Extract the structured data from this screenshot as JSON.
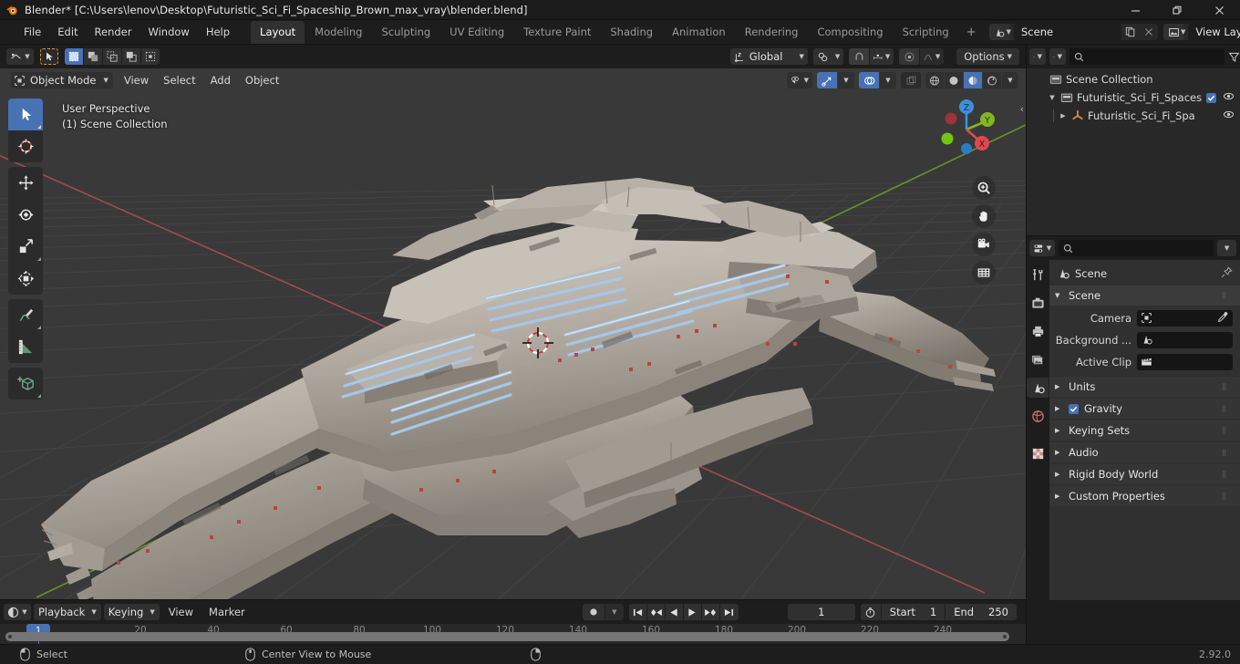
{
  "window": {
    "title": "Blender* [C:\\Users\\lenov\\Desktop\\Futuristic_Sci_Fi_Spaceship_Brown_max_vray\\blender.blend]",
    "minimize": "–",
    "maximize": "❐",
    "close": "✕"
  },
  "topbar": {
    "menus": [
      "File",
      "Edit",
      "Render",
      "Window",
      "Help"
    ],
    "workspaces": [
      {
        "label": "Layout",
        "active": true
      },
      {
        "label": "Modeling",
        "active": false
      },
      {
        "label": "Sculpting",
        "active": false
      },
      {
        "label": "UV Editing",
        "active": false
      },
      {
        "label": "Texture Paint",
        "active": false
      },
      {
        "label": "Shading",
        "active": false
      },
      {
        "label": "Animation",
        "active": false
      },
      {
        "label": "Rendering",
        "active": false
      },
      {
        "label": "Compositing",
        "active": false
      },
      {
        "label": "Scripting",
        "active": false
      }
    ],
    "add_workspace": "+",
    "scene_name": "Scene",
    "view_layer_name": "View Layer"
  },
  "viewport_header": {
    "editor_type_icon": "editor-type-icon",
    "cursor_tool_icon": "cursor-tool-icon",
    "select_modes": [
      "select-set",
      "select-extend",
      "select-subtract",
      "select-invert",
      "select-intersect"
    ],
    "mode": "Object Mode",
    "menus": [
      "View",
      "Select",
      "Add",
      "Object"
    ],
    "transform_orientation": "Global",
    "snap_icon": "magnet-icon",
    "proportional_icon": "proportional-edit-icon",
    "options": "Options",
    "shading_modes": [
      "wireframe",
      "solid",
      "material-preview",
      "rendered"
    ],
    "active_shading": "material-preview"
  },
  "viewport": {
    "perspective_label": "User Perspective",
    "collection_label": "(1) Scene Collection",
    "gizmo_axes": [
      {
        "label": "Z",
        "color": "#3e8fd8"
      },
      {
        "label": "Y",
        "color": "#83b524"
      },
      {
        "label": "X",
        "color": "#e0484f"
      }
    ],
    "nav_buttons": [
      "zoom-icon",
      "pan-hand-icon",
      "camera-view-icon",
      "toggle-ortho-icon"
    ],
    "tools": [
      {
        "name": "tweak-select-tool",
        "selected": true
      },
      {
        "name": "cursor-tool",
        "selected": false
      },
      {
        "name": "move-tool",
        "selected": false
      },
      {
        "name": "rotate-tool",
        "selected": false
      },
      {
        "name": "scale-tool",
        "selected": false
      },
      {
        "name": "transform-tool",
        "selected": false
      },
      {
        "name": "annotate-tool",
        "selected": false
      },
      {
        "name": "measure-tool",
        "selected": false
      },
      {
        "name": "add-cube-tool",
        "selected": false
      }
    ]
  },
  "outliner": {
    "display_mode_icon": "outliner-display-mode-icon",
    "filter_icon": "filter-icon",
    "search_placeholder": "",
    "rows": [
      {
        "name": "Scene Collection",
        "indent": 0,
        "icon": "collection-icon",
        "disclosure": "",
        "has_check": false,
        "has_eye": false
      },
      {
        "name": "Futuristic_Sci_Fi_Spaces",
        "indent": 1,
        "icon": "collection-icon",
        "disclosure": "▼",
        "has_check": true,
        "has_eye": true
      },
      {
        "name": "Futuristic_Sci_Fi_Spa",
        "indent": 2,
        "icon": "object-empty-axes-icon",
        "disclosure": "▶",
        "has_check": false,
        "has_eye": true
      }
    ]
  },
  "properties": {
    "editor_icon": "properties-editor-icon",
    "search_placeholder": "",
    "tabs": [
      {
        "name": "tool-tab",
        "icon": "tool-icon",
        "active": false
      },
      {
        "name": "render-tab",
        "icon": "render-camera-icon",
        "active": false
      },
      {
        "name": "output-tab",
        "icon": "printer-icon",
        "active": false
      },
      {
        "name": "view-layer-tab",
        "icon": "images-icon",
        "active": false
      },
      {
        "name": "scene-tab",
        "icon": "scene-cone-icon",
        "active": true
      },
      {
        "name": "world-tab",
        "icon": "world-globe-icon",
        "active": false
      },
      {
        "name": "texture-tab",
        "icon": "checker-texture-icon",
        "active": false
      }
    ],
    "breadcrumb": "Scene",
    "panels": [
      {
        "title": "Scene",
        "open": true
      },
      {
        "title": "Units",
        "open": false,
        "checkbox": false
      },
      {
        "title": "Gravity",
        "open": false,
        "checkbox": true
      },
      {
        "title": "Keying Sets",
        "open": false,
        "checkbox": false
      },
      {
        "title": "Audio",
        "open": false,
        "checkbox": false
      },
      {
        "title": "Rigid Body World",
        "open": false,
        "checkbox": false
      },
      {
        "title": "Custom Properties",
        "open": false,
        "checkbox": false
      }
    ],
    "fields": [
      {
        "label": "Camera",
        "value": "",
        "icon": "camera-object-icon",
        "extra": "eyedropper-icon"
      },
      {
        "label": "Background ...",
        "value": "",
        "icon": "scene-cone-icon",
        "extra": ""
      },
      {
        "label": "Active Clip",
        "value": "",
        "icon": "clapperboard-icon",
        "extra": ""
      }
    ]
  },
  "timeline": {
    "editor_icon": "timeline-editor-icon",
    "menus_dropdown": [
      "Playback",
      "Keying"
    ],
    "menus": [
      "View",
      "Marker"
    ],
    "record_icon": "record-icon",
    "playback_buttons": [
      "jump-to-start",
      "prev-keyframe",
      "play-reverse",
      "play",
      "next-keyframe",
      "jump-to-end"
    ],
    "current_frame": "1",
    "timer_icon": "stopwatch-icon",
    "start_label": "Start",
    "start_value": "1",
    "end_label": "End",
    "end_value": "250",
    "ruler_ticks": [
      "20",
      "40",
      "60",
      "80",
      "100",
      "120",
      "140",
      "160",
      "180",
      "200",
      "220",
      "240"
    ],
    "playhead_frame": "1"
  },
  "statusbar": {
    "items": [
      {
        "icon": "mouse-left-icon",
        "text": "Select"
      },
      {
        "icon": "mouse-middle-icon",
        "text": "Center View to Mouse"
      },
      {
        "icon": "mouse-right-icon",
        "text": ""
      }
    ],
    "version": "2.92.0"
  },
  "colors": {
    "accent": "#4772b3",
    "header_bg": "#1d1d1d",
    "panel_bg": "#303030",
    "viewport_bg": "#393939",
    "axis_x": "#b54a4a",
    "axis_y": "#7ba428"
  }
}
